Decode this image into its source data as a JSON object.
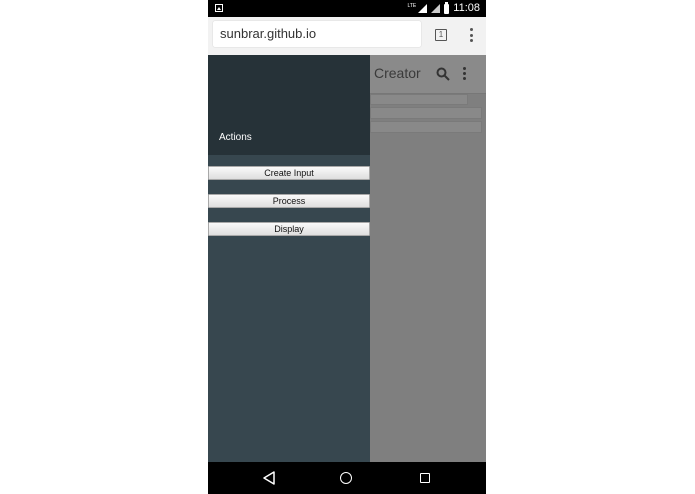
{
  "status_bar": {
    "time": "11:08",
    "network": "LTE"
  },
  "browser": {
    "url": "sunbrar.github.io",
    "tab_count": "1"
  },
  "app": {
    "title": "Creator"
  },
  "drawer": {
    "header_title": "Actions",
    "buttons": [
      {
        "label": "Create Input"
      },
      {
        "label": "Process"
      },
      {
        "label": "Display"
      }
    ]
  },
  "icons": {
    "status": [
      "image-icon",
      "lte-icon",
      "signal-icon",
      "battery-icon"
    ],
    "browser": [
      "tab-switcher-icon",
      "more-vert-icon"
    ],
    "app": [
      "search-icon",
      "more-vert-icon"
    ],
    "nav": [
      "back-icon",
      "home-icon",
      "recents-icon"
    ]
  },
  "colors": {
    "drawer_header": "#263238",
    "drawer_body": "#37474f",
    "scrim": "#7f7f7f"
  }
}
